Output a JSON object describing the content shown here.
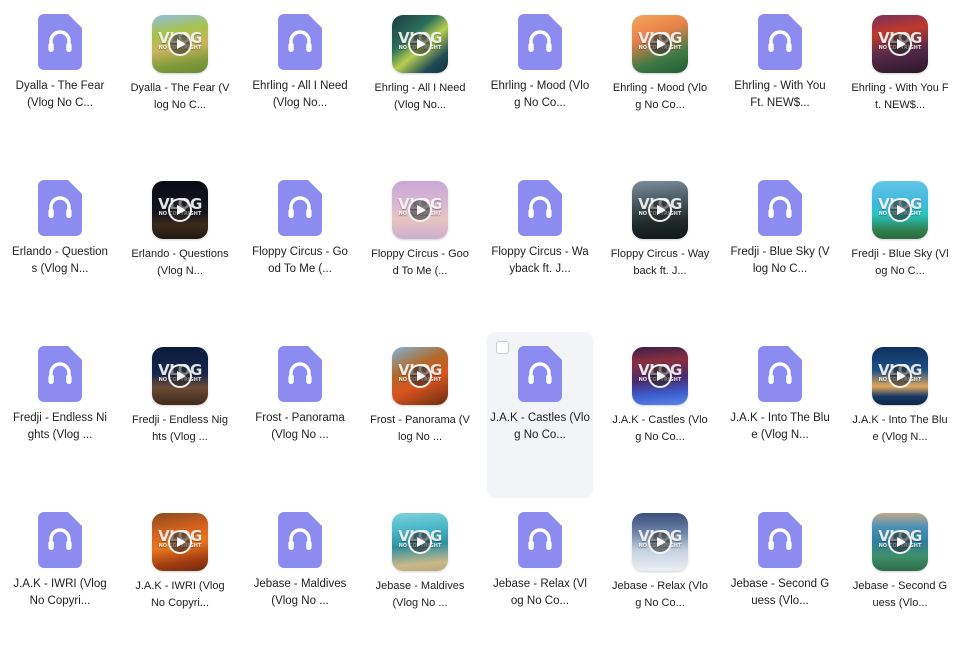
{
  "view": {
    "name": "file-grid",
    "columns": 8,
    "rows": 4,
    "background_color": "#ffffff",
    "hover_background_color": "#f2f4f8",
    "audio_icon_color": "#8c8cf0",
    "text_color": "#202124"
  },
  "watermark": {
    "line1": "VLOG",
    "line2": "NO COPYRIGHT"
  },
  "items": [
    {
      "label": "Dyalla - The Fear (Vlog No C...",
      "type": "audio",
      "icon": "audio-file-headphone-icon",
      "hovered": false
    },
    {
      "label": "Dyalla - The Fear (Vlog No C...",
      "type": "video",
      "icon": "video-thumbnail",
      "thumb": "linear-gradient(170deg,#8fbfe0 0%,#a8c24a 30%,#c9b45e 55%,#7f9a3a 80%,#6d8a33 100%)",
      "hovered": false
    },
    {
      "label": "Ehrling - All I Need (Vlog No...",
      "type": "audio",
      "icon": "audio-file-headphone-icon",
      "hovered": false
    },
    {
      "label": "Ehrling - All I Need (Vlog No...",
      "type": "video",
      "icon": "video-thumbnail",
      "thumb": "linear-gradient(140deg,#1d3a3f 0%,#2b6f5c 35%,#b8cf4e 55%,#1f4a55 80%,#143039 100%)",
      "hovered": false
    },
    {
      "label": "Ehrling - Mood (Vlog No Co...",
      "type": "audio",
      "icon": "audio-file-headphone-icon",
      "hovered": false
    },
    {
      "label": "Ehrling - Mood (Vlog No Co...",
      "type": "video",
      "icon": "video-thumbnail",
      "thumb": "linear-gradient(160deg,#f3a75c 0%,#e8804a 35%,#3f7a44 70%,#245a35 100%)",
      "hovered": false
    },
    {
      "label": "Ehrling - With You Ft. NEW$...",
      "type": "audio",
      "icon": "audio-file-headphone-icon",
      "hovered": false
    },
    {
      "label": "Ehrling - With You Ft. NEW$...",
      "type": "video",
      "icon": "video-thumbnail",
      "thumb": "linear-gradient(170deg,#7a2f5e 0%,#c0392b 30%,#5a2b4a 60%,#2a1628 100%)",
      "hovered": false
    },
    {
      "label": "Erlando - Questions (Vlog N...",
      "type": "audio",
      "icon": "audio-file-headphone-icon",
      "hovered": false
    },
    {
      "label": "Erlando - Questions (Vlog N...",
      "type": "video",
      "icon": "video-thumbnail",
      "thumb": "linear-gradient(180deg,#0b0b16 0%,#15151f 55%,#3a2a1c 75%,#241a12 100%)",
      "hovered": false
    },
    {
      "label": "Floppy Circus - Good To Me (...",
      "type": "audio",
      "icon": "audio-file-headphone-icon",
      "hovered": false
    },
    {
      "label": "Floppy Circus - Good To Me (...",
      "type": "video",
      "icon": "video-thumbnail",
      "thumb": "linear-gradient(180deg,#c9a8d6 0%,#d9b7d2 40%,#e8c4c0 65%,#cbb0cd 100%)",
      "hovered": false
    },
    {
      "label": "Floppy Circus - Wayback ft. J...",
      "type": "audio",
      "icon": "audio-file-headphone-icon",
      "hovered": false
    },
    {
      "label": "Floppy Circus - Wayback ft. J...",
      "type": "video",
      "icon": "video-thumbnail",
      "thumb": "linear-gradient(175deg,#7e8d9c 0%,#4a5a62 35%,#1f2a28 70%,#10181a 100%)",
      "hovered": false
    },
    {
      "label": "Fredji - Blue Sky (Vlog No C...",
      "type": "audio",
      "icon": "audio-file-headphone-icon",
      "hovered": false
    },
    {
      "label": "Fredji - Blue Sky (Vlog No C...",
      "type": "video",
      "icon": "video-thumbnail",
      "thumb": "linear-gradient(180deg,#63c6e8 0%,#3fb8dd 38%,#28c4c0 58%,#2f7f4e 85%,#2a6b3e 100%)",
      "hovered": false
    },
    {
      "label": "Fredji - Endless Nights (Vlog ...",
      "type": "audio",
      "icon": "audio-file-headphone-icon",
      "hovered": false
    },
    {
      "label": "Fredji - Endless Nights (Vlog ...",
      "type": "video",
      "icon": "video-thumbnail",
      "thumb": "linear-gradient(180deg,#0c1b3a 0%,#13264d 45%,#6b4a33 70%,#3f2a1c 100%)",
      "hovered": false
    },
    {
      "label": "Frost - Panorama (Vlog No ...",
      "type": "audio",
      "icon": "audio-file-headphone-icon",
      "hovered": false
    },
    {
      "label": "Frost - Panorama (Vlog No ...",
      "type": "video",
      "icon": "video-thumbnail",
      "thumb": "linear-gradient(155deg,#7fb4d8 0%,#b06a2c 35%,#d9541f 60%,#6b2c10 100%)",
      "hovered": false
    },
    {
      "label": "J.A.K - Castles (Vlog No Co...",
      "type": "audio",
      "icon": "audio-file-headphone-icon",
      "hovered": true
    },
    {
      "label": "J.A.K - Castles (Vlog No Co...",
      "type": "video",
      "icon": "video-thumbnail",
      "thumb": "linear-gradient(175deg,#3a1f4a 0%,#8a2f3e 25%,#4a2a6e 55%,#3d5fd1 80%,#5b86e8 100%)",
      "hovered": false
    },
    {
      "label": "J.A.K - Into The Blue (Vlog N...",
      "type": "audio",
      "icon": "audio-file-headphone-icon",
      "hovered": false
    },
    {
      "label": "J.A.K - Into The Blue (Vlog N...",
      "type": "video",
      "icon": "video-thumbnail",
      "thumb": "linear-gradient(180deg,#10305e 0%,#1c4f86 40%,#e0a85c 68%,#163a66 85%,#0d2448 100%)",
      "hovered": false
    },
    {
      "label": "J.A.K - IWRI (Vlog No Copyri...",
      "type": "audio",
      "icon": "audio-file-headphone-icon",
      "hovered": false
    },
    {
      "label": "J.A.K - IWRI (Vlog No Copyri...",
      "type": "video",
      "icon": "video-thumbnail",
      "thumb": "linear-gradient(170deg,#8a4a1e 0%,#d2601f 30%,#e8761f 55%,#a33c12 80%,#6d2a0e 100%)",
      "hovered": false
    },
    {
      "label": "Jebase - Maldives (Vlog No ...",
      "type": "audio",
      "icon": "audio-file-headphone-icon",
      "hovered": false
    },
    {
      "label": "Jebase - Maldives (Vlog No ...",
      "type": "video",
      "icon": "video-thumbnail",
      "thumb": "linear-gradient(175deg,#7fd0d8 0%,#46b6c8 30%,#2f8f9e 55%,#c9b98a 85%,#b8a97c 100%)",
      "hovered": false
    },
    {
      "label": "Jebase - Relax (Vlog No Co...",
      "type": "audio",
      "icon": "audio-file-headphone-icon",
      "hovered": false
    },
    {
      "label": "Jebase - Relax (Vlog No Co...",
      "type": "video",
      "icon": "video-thumbnail",
      "thumb": "linear-gradient(180deg,#3a4f7a 0%,#6f86ab 35%,#c7d3e0 65%,#e8eef3 100%)",
      "hovered": false
    },
    {
      "label": "Jebase - Second Guess (Vlo...",
      "type": "audio",
      "icon": "audio-file-headphone-icon",
      "hovered": false
    },
    {
      "label": "Jebase - Second Guess (Vlo...",
      "type": "video",
      "icon": "video-thumbnail",
      "thumb": "linear-gradient(180deg,#bfa98a 0%,#4a8fb8 25%,#2f7f9e 50%,#3f8f6a 75%,#2c6b4a 100%)",
      "hovered": false
    }
  ]
}
